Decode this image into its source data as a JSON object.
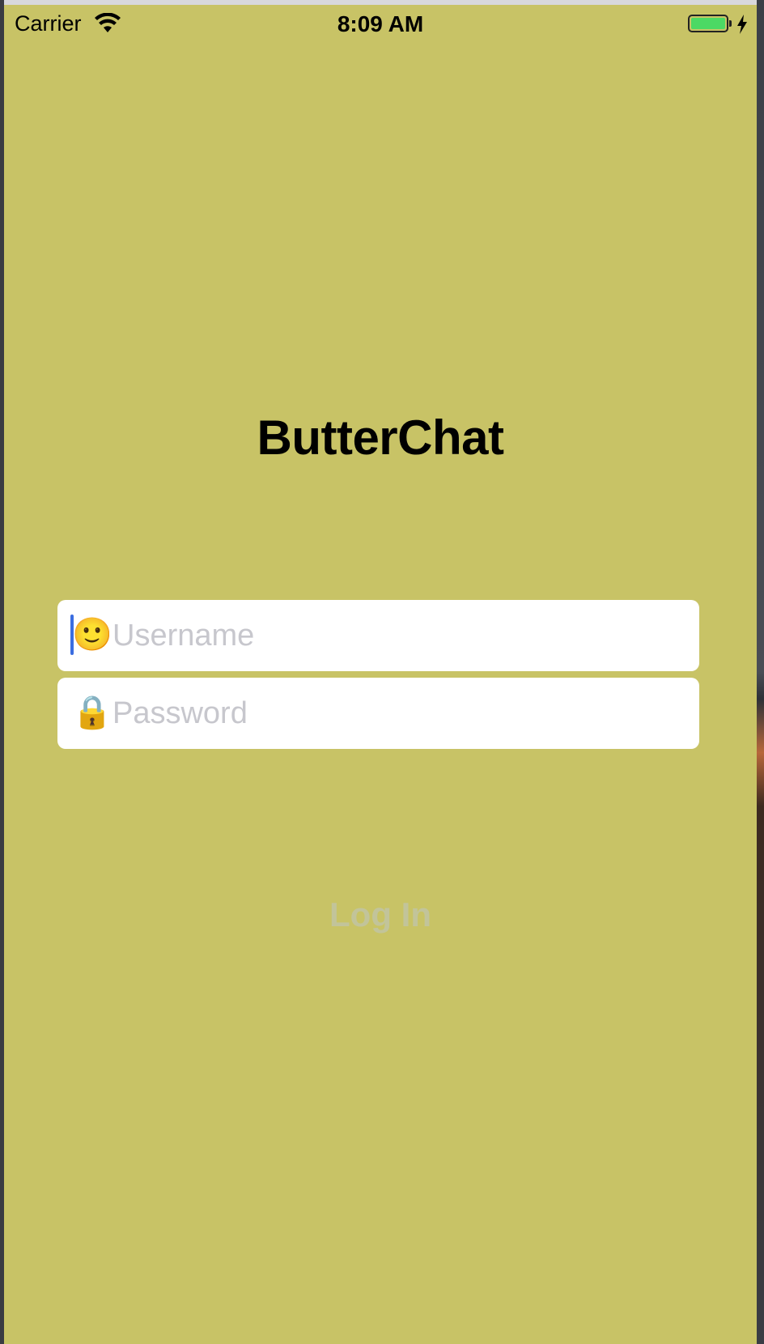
{
  "status_bar": {
    "carrier": "Carrier",
    "time": "8:09 AM",
    "wifi_icon": "wifi-icon",
    "battery_icon": "battery-charging-icon",
    "battery_color": "#4cd964"
  },
  "app": {
    "title": "ButterChat",
    "background_color": "#c8c366"
  },
  "form": {
    "username": {
      "icon": "slightly-smiling-face-icon",
      "icon_glyph": "🙂",
      "placeholder": "Username",
      "value": ""
    },
    "password": {
      "icon": "lock-icon",
      "icon_glyph": "🔒",
      "placeholder": "Password",
      "value": ""
    },
    "login_label": "Log In"
  }
}
